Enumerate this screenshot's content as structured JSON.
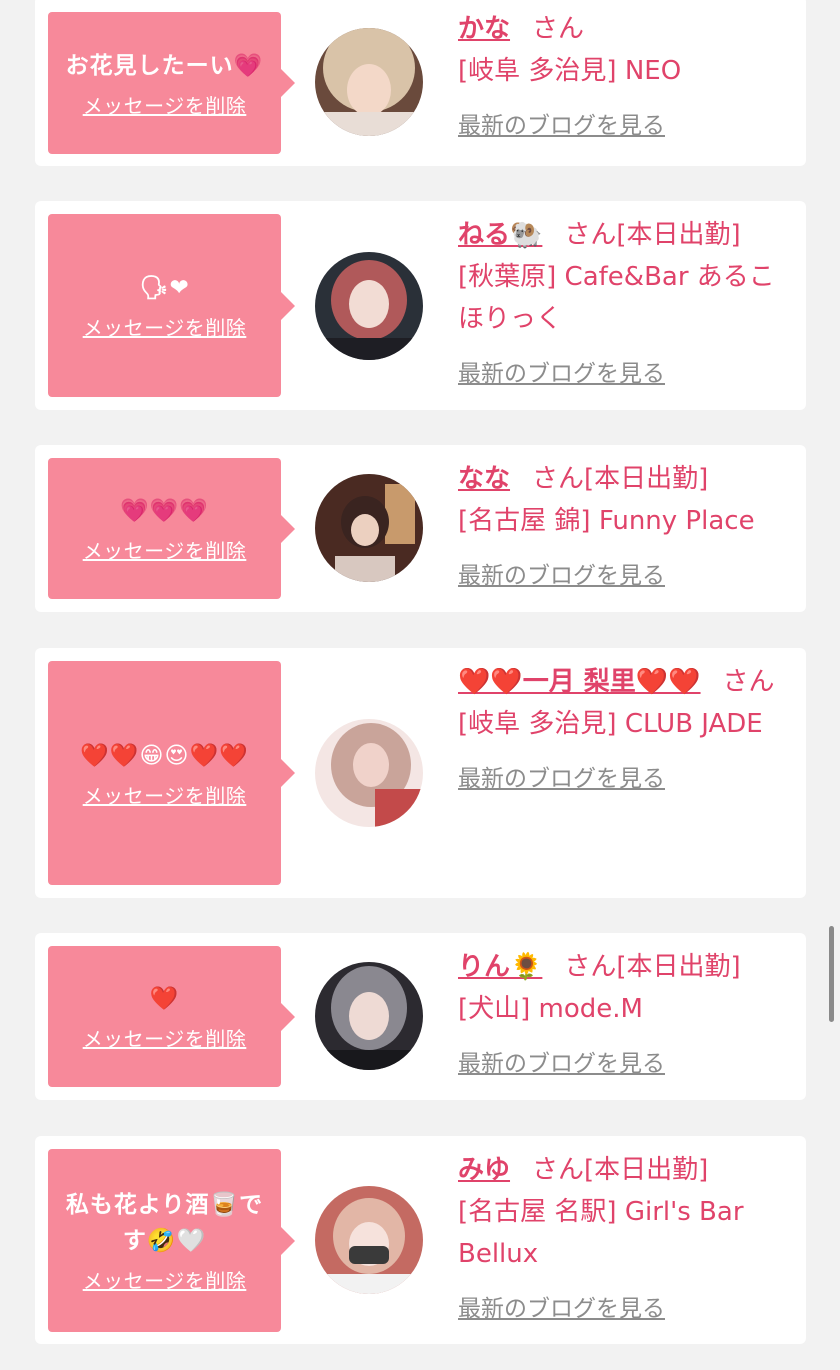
{
  "delete_label": "メッセージを削除",
  "blog_label": "最新のブログを見る",
  "san_label": "さん",
  "items": [
    {
      "message": "お花見したーい💗",
      "name": "かな",
      "status": "",
      "shop": "[岐阜 多治見] NEO"
    },
    {
      "message": "🗣❤",
      "name": "ねる🐏",
      "status": "[本日出勤]",
      "shop": "[秋葉原] Cafe&Bar あるこほりっく"
    },
    {
      "message": "💗💗💗",
      "name": "なな",
      "status": "[本日出勤]",
      "shop": "[名古屋 錦] Funny Place"
    },
    {
      "message": "❤️❤️😁😍❤️❤️",
      "name": "❤️❤️一月 梨里❤️❤️",
      "status": "",
      "shop": "[岐阜 多治見] CLUB JADE"
    },
    {
      "message": "❤️",
      "name": "りん🌻",
      "status": "[本日出勤]",
      "shop": "[犬山] mode.M"
    },
    {
      "message": "私も花より酒🥃です🤣🤍",
      "name": "みゆ",
      "status": "[本日出勤]",
      "shop": "[名古屋 名駅] Girl's Bar Bellux"
    }
  ],
  "colors": {
    "bubble": "#f7899a",
    "name": "#e0436a",
    "link": "#8c8c8c",
    "background": "#f2f2f2"
  }
}
